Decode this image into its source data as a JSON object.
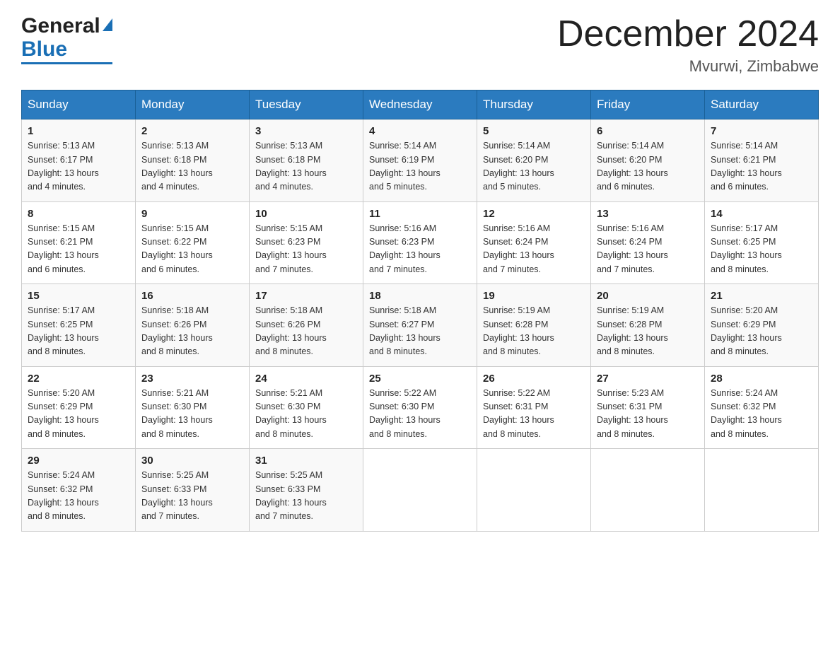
{
  "header": {
    "logo_general": "General",
    "logo_blue": "Blue",
    "month_year": "December 2024",
    "location": "Mvurwi, Zimbabwe"
  },
  "calendar": {
    "days_of_week": [
      "Sunday",
      "Monday",
      "Tuesday",
      "Wednesday",
      "Thursday",
      "Friday",
      "Saturday"
    ],
    "weeks": [
      [
        {
          "day": "1",
          "sunrise": "5:13 AM",
          "sunset": "6:17 PM",
          "daylight": "13 hours and 4 minutes."
        },
        {
          "day": "2",
          "sunrise": "5:13 AM",
          "sunset": "6:18 PM",
          "daylight": "13 hours and 4 minutes."
        },
        {
          "day": "3",
          "sunrise": "5:13 AM",
          "sunset": "6:18 PM",
          "daylight": "13 hours and 4 minutes."
        },
        {
          "day": "4",
          "sunrise": "5:14 AM",
          "sunset": "6:19 PM",
          "daylight": "13 hours and 5 minutes."
        },
        {
          "day": "5",
          "sunrise": "5:14 AM",
          "sunset": "6:20 PM",
          "daylight": "13 hours and 5 minutes."
        },
        {
          "day": "6",
          "sunrise": "5:14 AM",
          "sunset": "6:20 PM",
          "daylight": "13 hours and 6 minutes."
        },
        {
          "day": "7",
          "sunrise": "5:14 AM",
          "sunset": "6:21 PM",
          "daylight": "13 hours and 6 minutes."
        }
      ],
      [
        {
          "day": "8",
          "sunrise": "5:15 AM",
          "sunset": "6:21 PM",
          "daylight": "13 hours and 6 minutes."
        },
        {
          "day": "9",
          "sunrise": "5:15 AM",
          "sunset": "6:22 PM",
          "daylight": "13 hours and 6 minutes."
        },
        {
          "day": "10",
          "sunrise": "5:15 AM",
          "sunset": "6:23 PM",
          "daylight": "13 hours and 7 minutes."
        },
        {
          "day": "11",
          "sunrise": "5:16 AM",
          "sunset": "6:23 PM",
          "daylight": "13 hours and 7 minutes."
        },
        {
          "day": "12",
          "sunrise": "5:16 AM",
          "sunset": "6:24 PM",
          "daylight": "13 hours and 7 minutes."
        },
        {
          "day": "13",
          "sunrise": "5:16 AM",
          "sunset": "6:24 PM",
          "daylight": "13 hours and 7 minutes."
        },
        {
          "day": "14",
          "sunrise": "5:17 AM",
          "sunset": "6:25 PM",
          "daylight": "13 hours and 8 minutes."
        }
      ],
      [
        {
          "day": "15",
          "sunrise": "5:17 AM",
          "sunset": "6:25 PM",
          "daylight": "13 hours and 8 minutes."
        },
        {
          "day": "16",
          "sunrise": "5:18 AM",
          "sunset": "6:26 PM",
          "daylight": "13 hours and 8 minutes."
        },
        {
          "day": "17",
          "sunrise": "5:18 AM",
          "sunset": "6:26 PM",
          "daylight": "13 hours and 8 minutes."
        },
        {
          "day": "18",
          "sunrise": "5:18 AM",
          "sunset": "6:27 PM",
          "daylight": "13 hours and 8 minutes."
        },
        {
          "day": "19",
          "sunrise": "5:19 AM",
          "sunset": "6:28 PM",
          "daylight": "13 hours and 8 minutes."
        },
        {
          "day": "20",
          "sunrise": "5:19 AM",
          "sunset": "6:28 PM",
          "daylight": "13 hours and 8 minutes."
        },
        {
          "day": "21",
          "sunrise": "5:20 AM",
          "sunset": "6:29 PM",
          "daylight": "13 hours and 8 minutes."
        }
      ],
      [
        {
          "day": "22",
          "sunrise": "5:20 AM",
          "sunset": "6:29 PM",
          "daylight": "13 hours and 8 minutes."
        },
        {
          "day": "23",
          "sunrise": "5:21 AM",
          "sunset": "6:30 PM",
          "daylight": "13 hours and 8 minutes."
        },
        {
          "day": "24",
          "sunrise": "5:21 AM",
          "sunset": "6:30 PM",
          "daylight": "13 hours and 8 minutes."
        },
        {
          "day": "25",
          "sunrise": "5:22 AM",
          "sunset": "6:30 PM",
          "daylight": "13 hours and 8 minutes."
        },
        {
          "day": "26",
          "sunrise": "5:22 AM",
          "sunset": "6:31 PM",
          "daylight": "13 hours and 8 minutes."
        },
        {
          "day": "27",
          "sunrise": "5:23 AM",
          "sunset": "6:31 PM",
          "daylight": "13 hours and 8 minutes."
        },
        {
          "day": "28",
          "sunrise": "5:24 AM",
          "sunset": "6:32 PM",
          "daylight": "13 hours and 8 minutes."
        }
      ],
      [
        {
          "day": "29",
          "sunrise": "5:24 AM",
          "sunset": "6:32 PM",
          "daylight": "13 hours and 8 minutes."
        },
        {
          "day": "30",
          "sunrise": "5:25 AM",
          "sunset": "6:33 PM",
          "daylight": "13 hours and 7 minutes."
        },
        {
          "day": "31",
          "sunrise": "5:25 AM",
          "sunset": "6:33 PM",
          "daylight": "13 hours and 7 minutes."
        },
        null,
        null,
        null,
        null
      ]
    ]
  }
}
